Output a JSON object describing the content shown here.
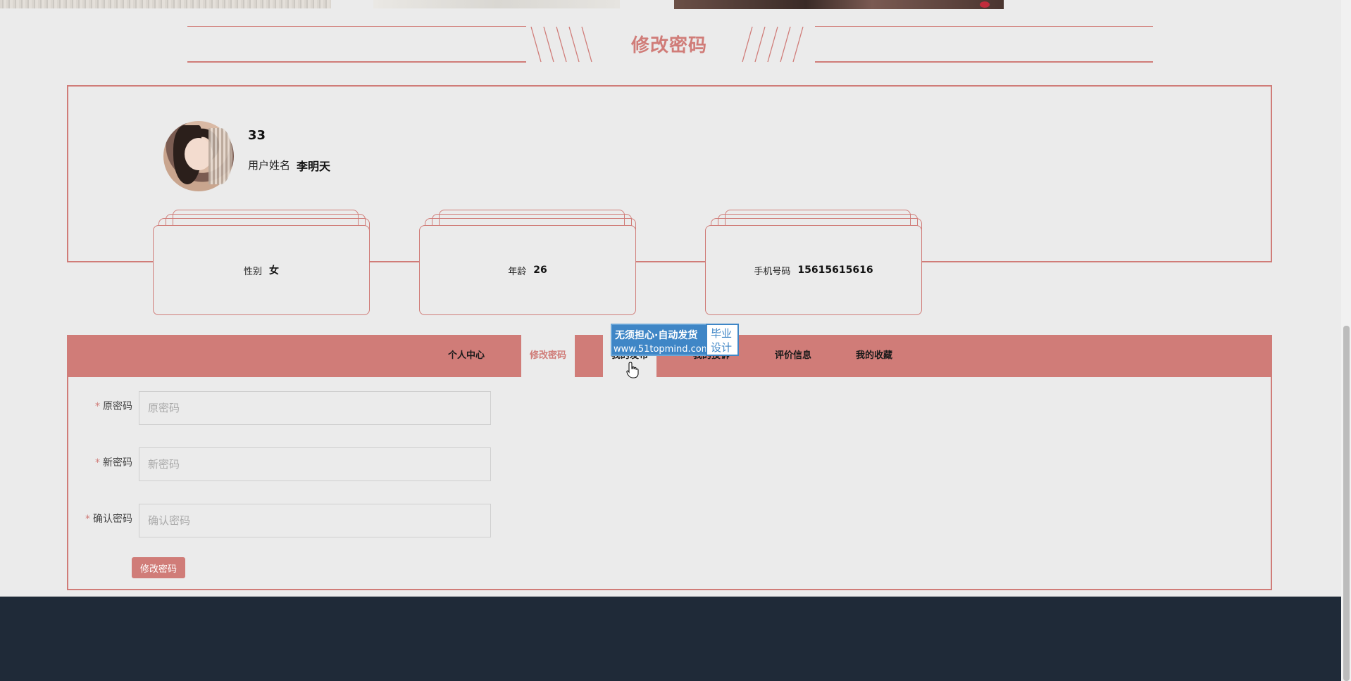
{
  "section": {
    "title": "修改密码"
  },
  "profile": {
    "username": "33",
    "realname_label": "用户姓名",
    "realname_value": "李明天"
  },
  "info_cards": [
    {
      "label": "性别",
      "value": "女"
    },
    {
      "label": "年龄",
      "value": "26"
    },
    {
      "label": "手机号码",
      "value": "15615615616"
    }
  ],
  "tabs": [
    {
      "label": "个人中心",
      "active": false
    },
    {
      "label": "修改密码",
      "active": true
    },
    {
      "label": "我的发布",
      "active": false
    },
    {
      "label": "我的投诉",
      "active": false
    },
    {
      "label": "评价信息",
      "active": false
    },
    {
      "label": "我的收藏",
      "active": false
    }
  ],
  "form": {
    "old_password": {
      "label": "原密码",
      "placeholder": "原密码",
      "required_mark": "*"
    },
    "new_password": {
      "label": "新密码",
      "placeholder": "新密码",
      "required_mark": "*"
    },
    "confirm_password": {
      "label": "确认密码",
      "placeholder": "确认密码",
      "required_mark": "*"
    },
    "submit_label": "修改密码"
  },
  "watermark": {
    "line1": "无须担心·自动发货",
    "line2": "www.51topmind.com",
    "side1": "毕业",
    "side2": "设计"
  },
  "colors": {
    "accent": "#d07c78",
    "background": "#ebebeb",
    "footer": "#1f2a38",
    "watermark": "#3f86c6"
  }
}
